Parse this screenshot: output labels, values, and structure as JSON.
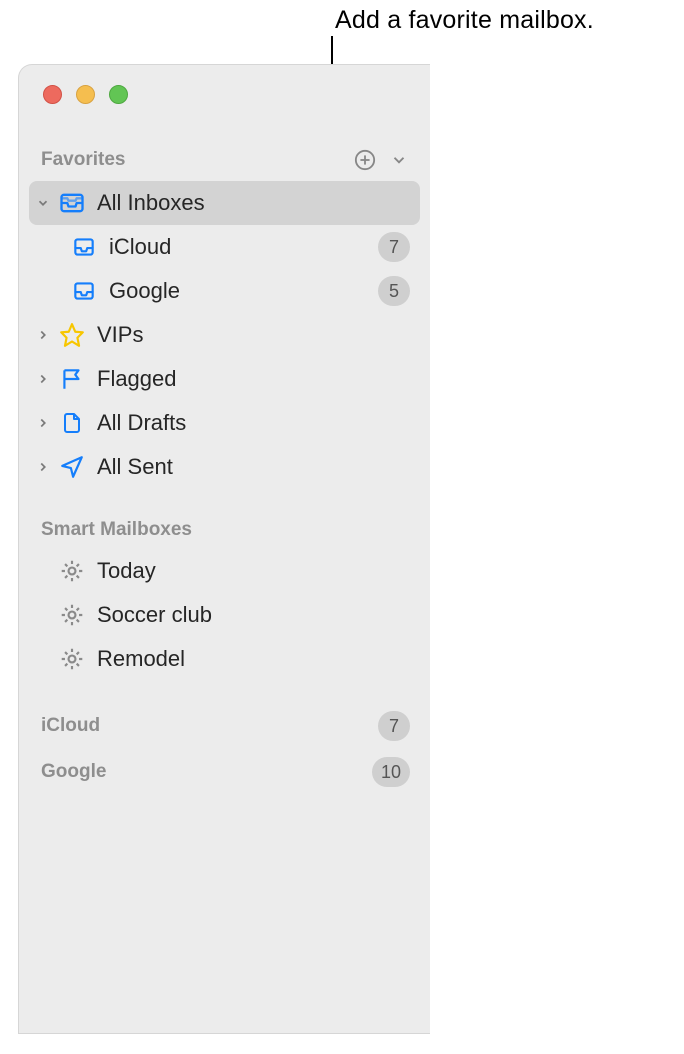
{
  "annotation": "Add a favorite mailbox.",
  "sections": {
    "favorites": {
      "title": "Favorites",
      "items": [
        {
          "label": "All Inboxes",
          "icon": "all-inboxes",
          "disclosure": "down",
          "selected": true
        },
        {
          "label": "iCloud",
          "icon": "inbox",
          "sub": true,
          "badge": "7"
        },
        {
          "label": "Google",
          "icon": "inbox",
          "sub": true,
          "badge": "5"
        },
        {
          "label": "VIPs",
          "icon": "star",
          "disclosure": "right"
        },
        {
          "label": "Flagged",
          "icon": "flag",
          "disclosure": "right"
        },
        {
          "label": "All Drafts",
          "icon": "doc",
          "disclosure": "right"
        },
        {
          "label": "All Sent",
          "icon": "paperplane",
          "disclosure": "right"
        }
      ]
    },
    "smart": {
      "title": "Smart Mailboxes",
      "items": [
        {
          "label": "Today",
          "icon": "gear"
        },
        {
          "label": "Soccer club",
          "icon": "gear"
        },
        {
          "label": "Remodel",
          "icon": "gear"
        }
      ]
    }
  },
  "accounts": [
    {
      "label": "iCloud",
      "badge": "7"
    },
    {
      "label": "Google",
      "badge": "10"
    }
  ],
  "colors": {
    "iconBlue": "#157efb",
    "iconYellow": "#f7c600",
    "iconGray": "#8a8a8a"
  }
}
